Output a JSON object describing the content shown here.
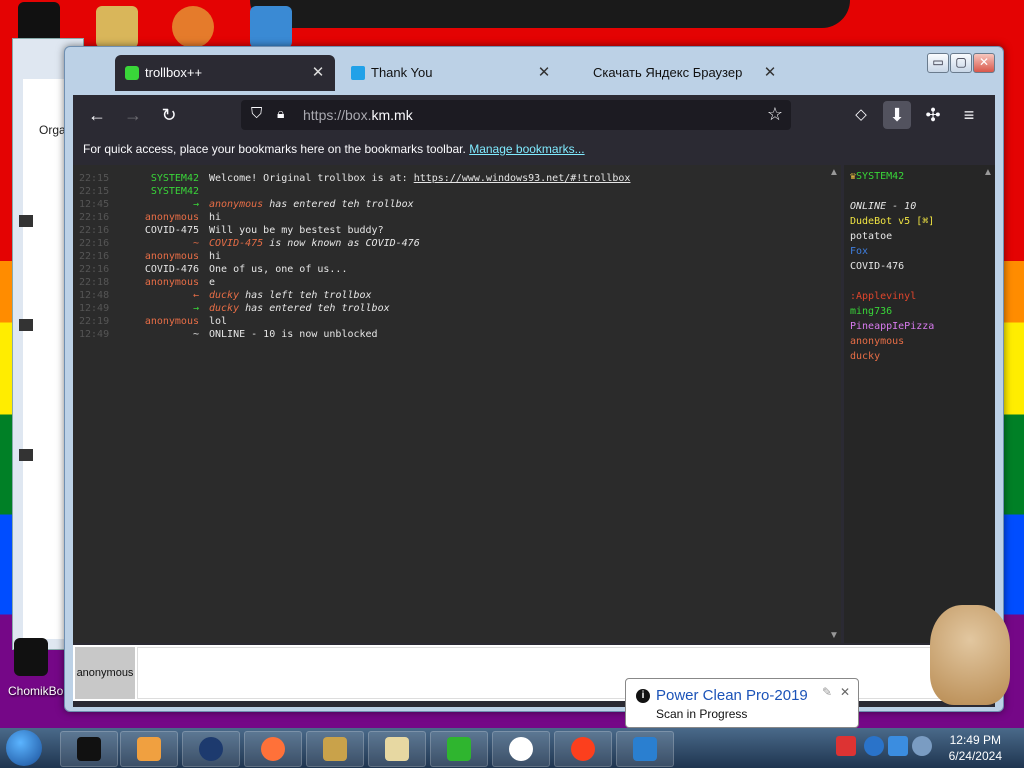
{
  "desktop": {
    "labels": [
      "ChomikBo"
    ],
    "bg_window_label": "Orga"
  },
  "window": {
    "controls": {
      "minimize": "▭",
      "maximize": "▢",
      "close": "✕"
    }
  },
  "tabs": [
    {
      "label": "trollbox++",
      "active": true,
      "icon": "trollbox-icon"
    },
    {
      "label": "Thank You",
      "active": false,
      "icon": "page-icon"
    },
    {
      "label": "Скачать Яндекс Браузер",
      "active": false,
      "icon": ""
    }
  ],
  "navbar": {
    "back": "←",
    "forward": "→",
    "reload": "↻",
    "url_prefix": "https://box.",
    "url_domain": "km.mk",
    "star": "☆",
    "pocket": "◇",
    "download": "⬇",
    "extensions": "✣",
    "menu": "≡"
  },
  "bookmarks_bar": {
    "text": "For quick access, place your bookmarks here on the bookmarks toolbar.",
    "link": "Manage bookmarks..."
  },
  "chat": {
    "lines": [
      {
        "time": "22:15",
        "nick": "SYSTEM42",
        "nick_color": "#39d639",
        "msg": "Welcome! Original trollbox is at: ",
        "link": "https://www.windows93.net/#!trollbox",
        "msg_color": "#e6e6e6",
        "italic": false
      },
      {
        "time": "22:15",
        "nick": "SYSTEM42",
        "nick_color": "#39d639",
        "msg": "",
        "link": "",
        "msg_color": "#e6e6e6",
        "italic": false
      },
      {
        "time": "12:45",
        "nick": "→",
        "nick_color": "#39d639",
        "msg_nick": "anonymous",
        "msg_nick_color": "#e66d46",
        "msg": " has entered teh trollbox",
        "link": "",
        "msg_color": "#e6e6e6",
        "italic": true
      },
      {
        "time": "22:16",
        "nick": "anonymous",
        "nick_color": "#e66d46",
        "msg": "hi",
        "link": "",
        "msg_color": "#e6e6e6",
        "italic": false
      },
      {
        "time": "22:16",
        "nick": "COVID-475",
        "nick_color": "#e6e6e6",
        "msg": "Will you be my bestest buddy?",
        "link": "",
        "msg_color": "#e6e6e6",
        "italic": false
      },
      {
        "time": "22:16",
        "nick": "~",
        "nick_color": "#e66d46",
        "msg_nick": "COVID-475",
        "msg_nick_color": "#e66d46",
        "msg": " is now known as COVID-476",
        "link": "",
        "msg_color": "#e6e6e6",
        "italic": true
      },
      {
        "time": "22:16",
        "nick": "anonymous",
        "nick_color": "#e66d46",
        "msg": "hi",
        "link": "",
        "msg_color": "#e6e6e6",
        "italic": false
      },
      {
        "time": "22:16",
        "nick": "COVID-476",
        "nick_color": "#e6e6e6",
        "msg": "One of us, one of us...",
        "link": "",
        "msg_color": "#e6e6e6",
        "italic": false
      },
      {
        "time": "22:18",
        "nick": "anonymous",
        "nick_color": "#e66d46",
        "msg": "e",
        "link": "",
        "msg_color": "#e6e6e6",
        "italic": false
      },
      {
        "time": "12:48",
        "nick": "←",
        "nick_color": "#e66d46",
        "msg_nick": "ducky",
        "msg_nick_color": "#e66d46",
        "msg": " has left teh trollbox",
        "link": "",
        "msg_color": "#e6e6e6",
        "italic": true
      },
      {
        "time": "12:49",
        "nick": "→",
        "nick_color": "#39d639",
        "msg_nick": "ducky",
        "msg_nick_color": "#e66d46",
        "msg": " has entered teh trollbox",
        "link": "",
        "msg_color": "#e6e6e6",
        "italic": true
      },
      {
        "time": "22:19",
        "nick": "anonymous",
        "nick_color": "#e66d46",
        "msg": "lol",
        "link": "",
        "msg_color": "#e6e6e6",
        "italic": false
      },
      {
        "time": "12:49",
        "nick": "~",
        "nick_color": "#e6e6e6",
        "msg": "ONLINE - 10 is now unblocked",
        "link": "",
        "msg_color": "#e6e6e6",
        "italic": false
      }
    ]
  },
  "users": {
    "header": "SYSTEM42",
    "header_color": "#39d639",
    "online": "ONLINE - 10",
    "list": [
      {
        "name": "DudeBot v5 [⌘]",
        "color": "#f0e442"
      },
      {
        "name": "potatoe",
        "color": "#e6e6e6"
      },
      {
        "name": "Fox",
        "color": "#3f7fe0"
      },
      {
        "name": "COVID-476",
        "color": "#e6e6e6"
      },
      {
        "name": ":Applevinyl",
        "color": "#e0452c"
      },
      {
        "name": "ming736",
        "color": "#39d639"
      },
      {
        "name": "PineappIePizza",
        "color": "#d97bf0"
      },
      {
        "name": "anonymous",
        "color": "#e66d46"
      },
      {
        "name": "ducky",
        "color": "#e66d46"
      }
    ]
  },
  "input": {
    "nick": "anonymous",
    "value": ""
  },
  "notification": {
    "title": "Power Clean Pro-2019",
    "subtitle": "Scan in Progress",
    "info": "i",
    "close": "✕"
  },
  "taskbar": {
    "time": "12:49 PM",
    "date": "6/24/2024",
    "apps": [
      "terminal",
      "media-player",
      "globe",
      "firefox",
      "chomikbox",
      "mail",
      "yandex-green",
      "yandex",
      "yandex-red",
      "security"
    ]
  }
}
